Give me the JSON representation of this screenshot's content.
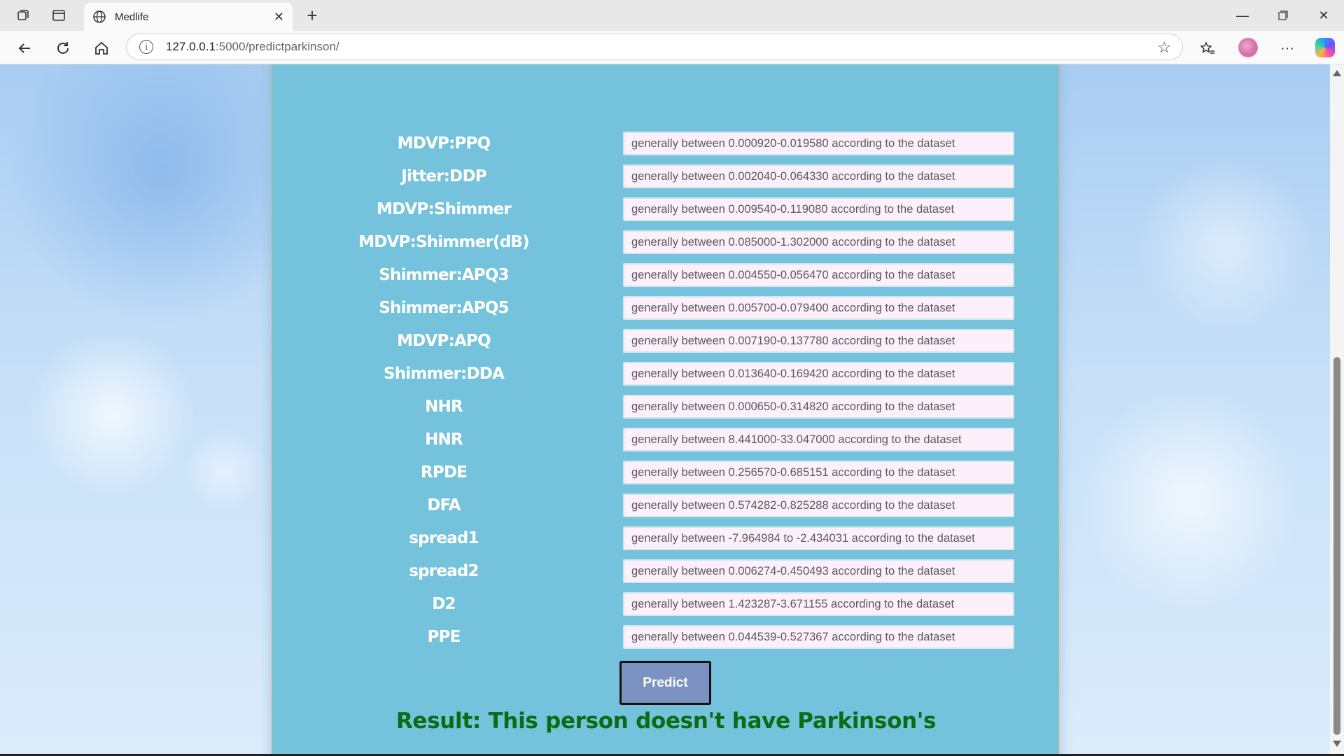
{
  "browser": {
    "tab_title": "Medlife",
    "url_host": "127.0.0.1",
    "url_path": ":5000/predictparkinson/"
  },
  "form": {
    "fields": [
      {
        "label": "MDVP:PPQ",
        "placeholder": "generally between 0.000920-0.019580 according to the dataset"
      },
      {
        "label": "Jitter:DDP",
        "placeholder": "generally between 0.002040-0.064330 according to the dataset"
      },
      {
        "label": "MDVP:Shimmer",
        "placeholder": "generally between 0.009540-0.119080 according to the dataset"
      },
      {
        "label": "MDVP:Shimmer(dB)",
        "placeholder": "generally between 0.085000-1.302000 according to the dataset"
      },
      {
        "label": "Shimmer:APQ3",
        "placeholder": "generally between 0.004550-0.056470 according to the dataset"
      },
      {
        "label": "Shimmer:APQ5",
        "placeholder": "generally between 0.005700-0.079400 according to the dataset"
      },
      {
        "label": "MDVP:APQ",
        "placeholder": "generally between 0.007190-0.137780 according to the dataset"
      },
      {
        "label": "Shimmer:DDA",
        "placeholder": "generally between 0.013640-0.169420 according to the dataset"
      },
      {
        "label": "NHR",
        "placeholder": "generally between 0.000650-0.314820 according to the dataset"
      },
      {
        "label": "HNR",
        "placeholder": "generally between 8.441000-33.047000 according to the dataset"
      },
      {
        "label": "RPDE",
        "placeholder": "generally between 0.256570-0.685151 according to the dataset"
      },
      {
        "label": "DFA",
        "placeholder": "generally between 0.574282-0.825288 according to the dataset"
      },
      {
        "label": "spread1",
        "placeholder": "generally between -7.964984 to -2.434031 according to the dataset"
      },
      {
        "label": "spread2",
        "placeholder": "generally between 0.006274-0.450493 according to the dataset"
      },
      {
        "label": "D2",
        "placeholder": "generally between 1.423287-3.671155 according to the dataset"
      },
      {
        "label": "PPE",
        "placeholder": "generally between 0.044539-0.527367 according to the dataset"
      }
    ],
    "predict_label": "Predict",
    "result_text": "Result: This person doesn't have Parkinson's"
  },
  "colors": {
    "card_bg": "#75c2dc",
    "field_bg": "#fdf0fb",
    "button_bg": "#7c92c2",
    "result_text": "#0c6b15"
  }
}
